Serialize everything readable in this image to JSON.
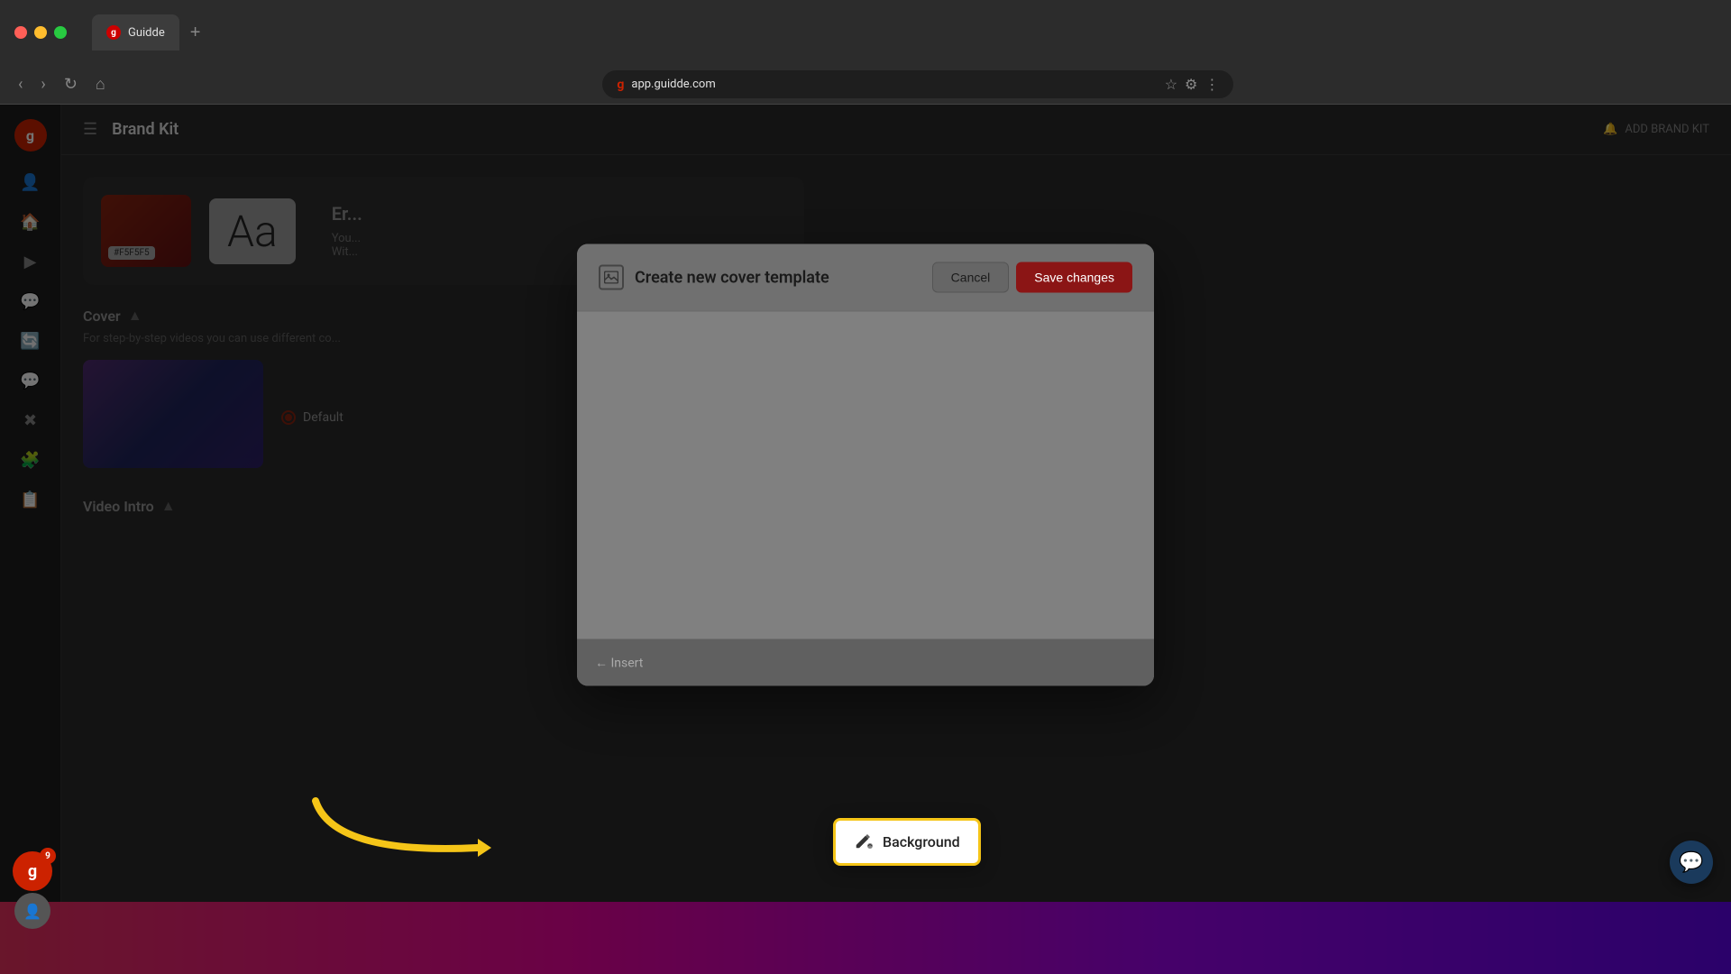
{
  "browser": {
    "tab_title": "Guidde",
    "tab_icon": "g",
    "url": "app.guidde.com",
    "new_tab_label": "+"
  },
  "sidebar": {
    "menu_icon": "☰",
    "icons": [
      "👤",
      "🏠",
      "▶",
      "💬",
      "🔄",
      "💬",
      "✖",
      "🧩",
      "📋"
    ]
  },
  "topbar": {
    "page_title": "Brand Kit",
    "add_brand_label": "ADD BRAND KIT"
  },
  "brand_section": {
    "color_hex": "#F5F5F5",
    "typography_text": "Aa",
    "section_label": "Cover",
    "section_desc": "For step-by-step videos you can use different co...",
    "default_label": "Default",
    "video_intro_label": "Video Intro"
  },
  "modal": {
    "title": "Create new cover template",
    "icon_label": "image",
    "cancel_label": "Cancel",
    "save_label": "Save changes",
    "insert_label": "Insert"
  },
  "background_popup": {
    "label": "Background",
    "icon": "🖌"
  },
  "colors": {
    "save_button_bg": "#8B1515",
    "arrow_color": "#f5c518",
    "popup_border": "#f5c518"
  }
}
